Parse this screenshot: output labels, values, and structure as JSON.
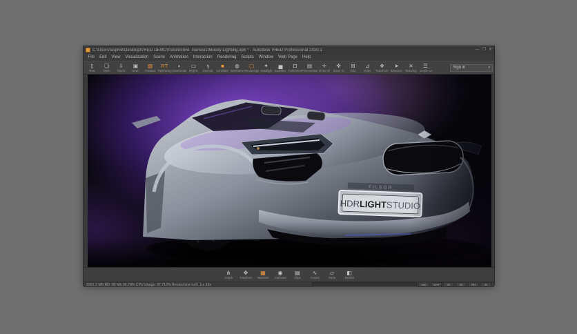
{
  "window": {
    "title": "C:\\Users\\sophie\\Desktop\\VRED DEMO\\Automotive_Genesis\\Moody Lighting.vpb * - Autodesk VRED Professional 2020.1",
    "controls": {
      "minimize": "—",
      "maximize": "❐",
      "close": "✕"
    }
  },
  "menu": {
    "items": [
      "File",
      "Edit",
      "View",
      "Visualization",
      "Scene",
      "Animation",
      "Interaction",
      "Rendering",
      "Scripts",
      "Window",
      "Web Page",
      "Help"
    ]
  },
  "toolbar": {
    "items": [
      {
        "label": "New",
        "glyph": "▯"
      },
      {
        "label": "Open",
        "glyph": "❏"
      },
      {
        "label": "Import",
        "glyph": "⇩"
      },
      {
        "label": "Save",
        "glyph": "▣"
      },
      {
        "label": "Antialias",
        "glyph": "▨",
        "accent": true
      },
      {
        "label": "Raytracing",
        "glyph": "RT",
        "accent": true
      },
      {
        "label": "Downscale",
        "glyph": "◗"
      },
      {
        "label": "Region",
        "glyph": "▭"
      },
      {
        "label": "Gamma",
        "glyph": "γ"
      },
      {
        "label": "Lensflare",
        "glyph": "■",
        "accent": true
      },
      {
        "label": "Wireframe",
        "glyph": "◍"
      },
      {
        "label": "Renderings",
        "glyph": "▢",
        "accent": true
      },
      {
        "label": "Headlight",
        "glyph": "✦"
      },
      {
        "label": "Statistics",
        "glyph": "▅"
      },
      {
        "label": "Fullscreen",
        "glyph": "⊡"
      },
      {
        "label": "Presentation",
        "glyph": "▤"
      },
      {
        "label": "Show All",
        "glyph": "✛"
      },
      {
        "label": "Zoom To",
        "glyph": "✜"
      },
      {
        "label": "Grid",
        "glyph": "⊞"
      },
      {
        "label": "Ruler",
        "glyph": "⊿"
      },
      {
        "label": "Transform",
        "glyph": "✥"
      },
      {
        "label": "Selection",
        "glyph": "➤"
      },
      {
        "label": "Texturing",
        "glyph": "✕"
      },
      {
        "label": "Simple UI",
        "glyph": "☰"
      }
    ],
    "signin": {
      "label": "Sign in",
      "caret": "▾"
    }
  },
  "viewport": {
    "plate": {
      "hdr": "HDR",
      "light": "LIGHT",
      "studio": "STUDIO",
      "top_text": "FILEGR"
    }
  },
  "modulebar": {
    "items": [
      {
        "label": "Graph",
        "glyph": "⋔"
      },
      {
        "label": "Transform",
        "glyph": "✥"
      },
      {
        "label": "Materials",
        "glyph": "▦",
        "accent": true
      },
      {
        "label": "Cameras",
        "glyph": "◉"
      },
      {
        "label": "Clips",
        "glyph": "▤"
      },
      {
        "label": "Curves",
        "glyph": "∿"
      },
      {
        "label": "Parts",
        "glyph": "▱"
      },
      {
        "label": "Render",
        "glyph": "◧"
      }
    ]
  },
  "statusbar": {
    "left": "3301.2 MB   RD: 85 Mb   36.78% CPU Usage: 87.712%   Rendertime Left: 1m 16s",
    "fields": [
      "mm",
      "60 ▾",
      "30",
      "45",
      "RH",
      "30"
    ]
  },
  "colors": {
    "accent_orange": "#e8973a",
    "glow_purple": "#8c50e0",
    "desktop_gray": "#6f6f6f",
    "chrome_gray": "#3a3a3a"
  }
}
